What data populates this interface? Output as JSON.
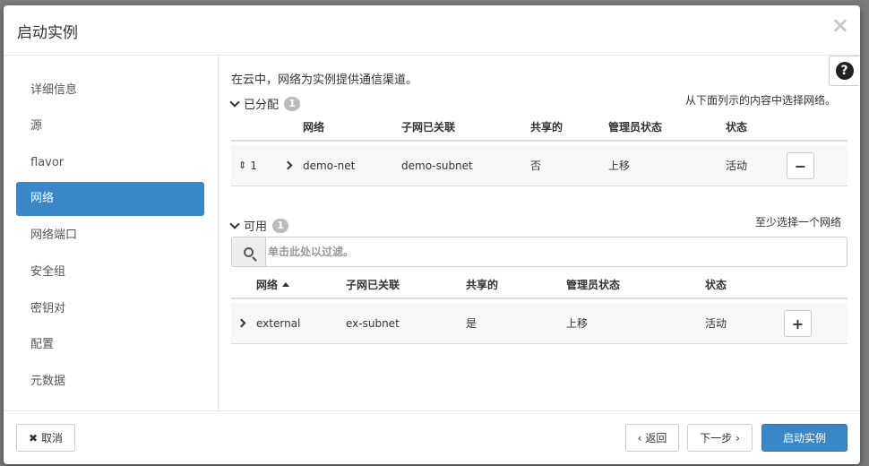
{
  "modal": {
    "title": "启动实例",
    "close_icon": "×"
  },
  "help": {
    "icon": "?"
  },
  "sidebar": {
    "items": [
      {
        "label": "详细信息"
      },
      {
        "label": "源"
      },
      {
        "label": "flavor"
      },
      {
        "label": "网络",
        "active": true
      },
      {
        "label": "网络端口"
      },
      {
        "label": "安全组"
      },
      {
        "label": "密钥对"
      },
      {
        "label": "配置"
      },
      {
        "label": "元数据"
      }
    ]
  },
  "main": {
    "intro": "在云中，网络为实例提供通信渠道。",
    "allocated": {
      "label": "已分配",
      "count": "1",
      "hint": "从下面列示的内容中选择网络。",
      "columns": [
        "网络",
        "子网已关联",
        "共享的",
        "管理员状态",
        "状态"
      ],
      "rows": [
        {
          "order": "1",
          "network": "demo-net",
          "subnet": "demo-subnet",
          "shared": "否",
          "admin_state": "上移",
          "status": "活动",
          "action": "−"
        }
      ]
    },
    "available": {
      "label": "可用",
      "count": "1",
      "hint": "至少选择一个网络",
      "filter_placeholder": "单击此处以过滤。",
      "columns": [
        "网络",
        "子网已关联",
        "共享的",
        "管理员状态",
        "状态"
      ],
      "rows": [
        {
          "network": "external",
          "subnet": "ex-subnet",
          "shared": "是",
          "admin_state": "上移",
          "status": "活动",
          "action": "+"
        }
      ]
    }
  },
  "footer": {
    "cancel": "取消",
    "cancel_icon": "✖",
    "back": "返回",
    "back_icon": "‹",
    "next": "下一步",
    "next_icon": "›",
    "launch": "启动实例"
  },
  "colors": {
    "primary": "#3a87c8",
    "badge": "#bbbbbb"
  }
}
